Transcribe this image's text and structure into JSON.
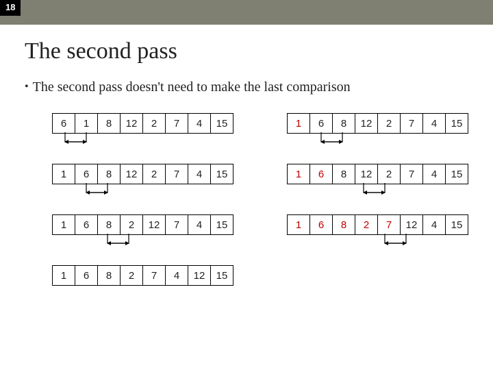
{
  "slide_number": "18",
  "title": "The second pass",
  "bullet": "The second pass doesn't need to make the last comparison",
  "left_arrays": [
    {
      "v": [
        "6",
        "1",
        "8",
        "12",
        "2",
        "7",
        "4",
        "15"
      ],
      "swap": [
        0,
        1
      ]
    },
    {
      "v": [
        "1",
        "6",
        "8",
        "12",
        "2",
        "7",
        "4",
        "15"
      ],
      "swap": [
        1,
        2
      ]
    },
    {
      "v": [
        "1",
        "6",
        "8",
        "2",
        "12",
        "7",
        "4",
        "15"
      ],
      "swap": [
        2,
        3
      ]
    },
    {
      "v": [
        "1",
        "6",
        "8",
        "2",
        "7",
        "4",
        "12",
        "15"
      ],
      "swap": null
    }
  ],
  "right_arrays": [
    {
      "v": [
        "1",
        "6",
        "8",
        "12",
        "2",
        "7",
        "4",
        "15"
      ],
      "swap": [
        1,
        2
      ],
      "red": [
        0
      ]
    },
    {
      "v": [
        "1",
        "6",
        "8",
        "12",
        "2",
        "7",
        "4",
        "15"
      ],
      "swap": [
        3,
        4
      ],
      "red": [
        0,
        1
      ]
    },
    {
      "v": [
        "1",
        "6",
        "8",
        "2",
        "7",
        "12",
        "4",
        "15"
      ],
      "swap": [
        4,
        5
      ],
      "red": [
        0,
        1,
        2,
        3,
        4
      ]
    }
  ]
}
